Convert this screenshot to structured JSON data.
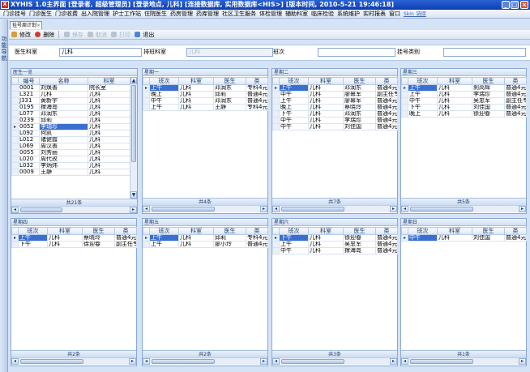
{
  "app": {
    "title": "XYHIS 1.0主界面  [登录者, 超级管理员] [登录地点, 儿科] [连接数据库, 实用数据库<HIS>] [版本时间, 2010-5-21 19:46:18]",
    "logo_text": "X"
  },
  "menu": {
    "items": [
      "门诊挂号",
      "门诊医生",
      "门诊收费",
      "出入院管理",
      "护士工作站",
      "住院医生",
      "药房管理",
      "药库管理",
      "社区卫生服务",
      "体检管理",
      "辅助科室",
      "临床检验",
      "系统维护",
      "实时报表",
      "窗口"
    ],
    "user_link": "Skin_链接"
  },
  "left_strip": {
    "label": "功能导航"
  },
  "doc_tab": {
    "label": "挂号周计划"
  },
  "toolbar": {
    "edit_label": "修改",
    "delete_label": "删除",
    "save_label": "保存",
    "cancel_label": "取消",
    "print_label": "打印",
    "exit_label": "退出"
  },
  "filters": {
    "doctor_dept_label": "医生科室",
    "doctor_dept_value": "儿科",
    "sched_dept_label": "排班科室",
    "sched_dept_value": "儿科",
    "shift_label": "班次",
    "shift_value": "",
    "reg_type_label": "挂号类别",
    "reg_type_value": ""
  },
  "doctor_panel": {
    "title": "医生一览",
    "columns": [
      "编号",
      "名称",
      "科室"
    ],
    "rows": [
      [
        "0001",
        "刘焕善",
        "院长室"
      ],
      [
        "L321",
        "儿科",
        "儿科"
      ],
      [
        "J331",
        "黄新宇",
        "儿科"
      ],
      [
        "0195",
        "撑海岛",
        "儿科"
      ],
      [
        "L077",
        "邓润东",
        "儿科"
      ],
      [
        "0239",
        "邱莉",
        "儿科"
      ],
      [
        "0052",
        "李瑞珍",
        "儿科"
      ],
      [
        "L092",
        "何凯",
        "儿科"
      ],
      [
        "L012",
        "诸健霞",
        "儿科"
      ],
      [
        "L069",
        "周汉善",
        "儿科"
      ],
      [
        "0055",
        "刘秀丽",
        "儿科"
      ],
      [
        "L020",
        "周代玫",
        "儿科"
      ],
      [
        "L032",
        "李炳炜",
        "儿科"
      ],
      [
        "0009",
        "王静",
        "儿科"
      ]
    ],
    "selected_index": 6,
    "footer": "共21条"
  },
  "schedule_columns": [
    "班次",
    "科室",
    "医生",
    "类"
  ],
  "days": [
    {
      "title": "星期一",
      "footer": "共4条",
      "rows": [
        [
          "上午",
          "儿科",
          "邓润东",
          "专科4元"
        ],
        [
          "晚上",
          "儿科",
          "邱莉",
          "普通4元"
        ],
        [
          "中午",
          "儿科",
          "邓润东",
          "普通4元"
        ],
        [
          "上午",
          "儿科",
          "王静",
          "专科4元"
        ]
      ]
    },
    {
      "title": "星期二",
      "footer": "共7条",
      "rows": [
        [
          "上午",
          "儿科",
          "邓润东",
          "普通4元"
        ],
        [
          "中午",
          "儿科",
          "廖幂军",
          "副主任专"
        ],
        [
          "上午",
          "儿科",
          "廖幂军",
          "普通4元"
        ],
        [
          "晚上",
          "儿科",
          "蔡晓玲",
          "普通4元"
        ],
        [
          "下午",
          "儿科",
          "邓润东",
          "普通4元"
        ],
        [
          "中午",
          "儿科",
          "李瑞珍",
          "普通4元"
        ],
        [
          "中午",
          "儿科",
          "刘佳国",
          "普通4元"
        ]
      ]
    },
    {
      "title": "星期三",
      "footer": "共5条",
      "rows": [
        [
          "上午",
          "儿科",
          "刹高辉",
          "普通4元"
        ],
        [
          "上午",
          "儿科",
          "李瑞珍",
          "普通4元"
        ],
        [
          "中午",
          "儿科",
          "吴忠军",
          "副主任专"
        ],
        [
          "下午",
          "儿科",
          "刘佳国",
          "普通4元"
        ],
        [
          "晚上",
          "儿科",
          "徐迎春",
          "普通4元"
        ]
      ]
    },
    {
      "title": "星期四",
      "footer": "共2条",
      "rows": [
        [
          "上午",
          "儿科",
          "蔡晓玲",
          "普通4元"
        ],
        [
          "下午",
          "儿科",
          "徐迎春",
          "副主任专"
        ]
      ]
    },
    {
      "title": "星期五",
      "footer": "共2条",
      "rows": [
        [
          "上午",
          "儿科",
          "邱莉",
          "专科4元"
        ],
        [
          "上午",
          "儿科",
          "廖小玲",
          "普通4元"
        ]
      ]
    },
    {
      "title": "星期六",
      "footer": "共3条",
      "rows": [
        [
          "下午",
          "儿科",
          "徐迎春",
          "普通4元"
        ],
        [
          "上午",
          "儿科",
          "吴忠军",
          "普通4元"
        ],
        [
          "中午",
          "儿科",
          "撑海岛",
          "普通4元"
        ]
      ]
    },
    {
      "title": "星期日",
      "footer": "共1条",
      "rows": [
        [
          "中午",
          "儿科",
          "刘佳国",
          "普通4元"
        ]
      ]
    }
  ]
}
